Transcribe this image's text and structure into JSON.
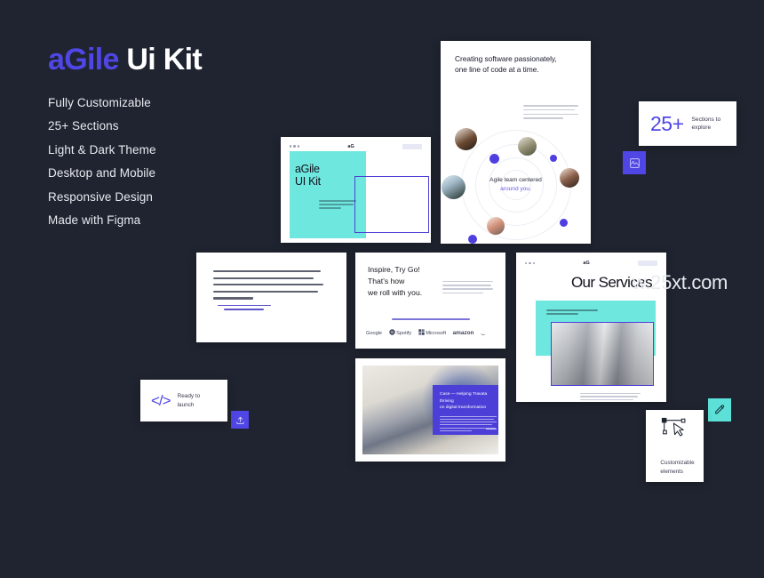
{
  "theme": {
    "background": "#1f2430",
    "accent_purple": "#4f46e5",
    "accent_teal": "#6ee7df",
    "text_light": "#e8eaf0"
  },
  "headline": {
    "title_accent": "aGile",
    "title_rest": " Ui Kit",
    "features": [
      "Fully Customizable",
      "25+ Sections",
      "Light & Dark Theme",
      "Desktop and Mobile",
      "Responsive Design",
      "Made with Figma"
    ]
  },
  "hero_card": {
    "heading_line1": "Creating software passionately,",
    "heading_line2": "one line of code at a time.",
    "orbit_label_line1": "Agile team centered",
    "orbit_label_line2": "around you."
  },
  "sections_badge": {
    "number": "25+",
    "caption_line1": "Sections to",
    "caption_line2": "explore"
  },
  "site_card": {
    "logo": "aG",
    "heading_line1": "aGile",
    "heading_line2": "UI Kit"
  },
  "inspire_card": {
    "heading_accent": "Inspire, Try Go!",
    "heading_line2": "That's how",
    "heading_line3": "we roll with you.",
    "brands": [
      "Google",
      "Spotify",
      "Microsoft",
      "amazon",
      "Nike"
    ]
  },
  "services_card": {
    "logo": "aG",
    "title": "Our Services"
  },
  "launch_card": {
    "icon_glyph": "</>",
    "caption_line1": "Ready to",
    "caption_line2": "launch"
  },
  "case_card": {
    "overlay_line1": "Case — Helping Travata thriving",
    "overlay_line2": "on digital transformation"
  },
  "custom_card": {
    "caption_line1": "Customizable",
    "caption_line2": "elements"
  },
  "chips": {
    "layers": "layers-icon",
    "pen": "pen-tool-icon",
    "upload": "upload-icon"
  },
  "watermark": {
    "text": "w.25xt.com"
  }
}
